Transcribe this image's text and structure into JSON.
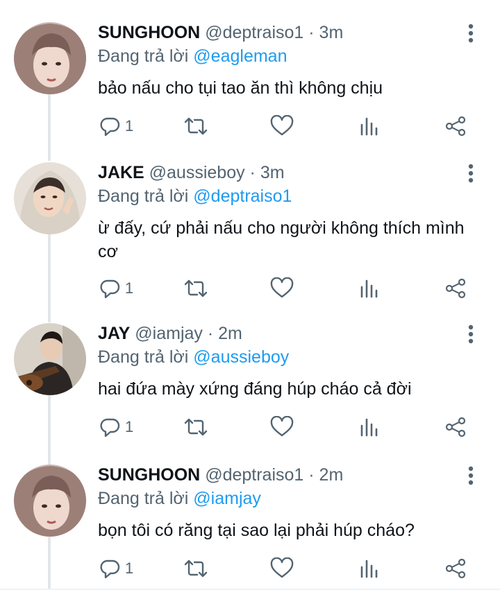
{
  "reply_prefix": "Đang trả lời",
  "tweets": [
    {
      "name": "SUNGHOON",
      "handle": "@deptraiso1",
      "time": "· 3m",
      "reply_to": "@eagleman",
      "text": "bảo nấu cho tụi tao ăn thì không chịu",
      "replies": "1"
    },
    {
      "name": "JAKE",
      "handle": "@aussieboy",
      "time": "· 3m",
      "reply_to": "@deptraiso1",
      "text": "ừ đấy, cứ phải nấu cho người không thích mình cơ",
      "replies": "1"
    },
    {
      "name": "JAY",
      "handle": "@iamjay",
      "time": "· 2m",
      "reply_to": "@aussieboy",
      "text": "hai đứa mày xứng đáng húp cháo cả đời",
      "replies": "1"
    },
    {
      "name": "SUNGHOON",
      "handle": "@deptraiso1",
      "time": "· 2m",
      "reply_to": "@iamjay",
      "text": "bọn tôi có răng tại sao lại phải húp cháo?",
      "replies": "1"
    }
  ],
  "icons": {
    "reply": "reply-icon",
    "retweet": "retweet-icon",
    "like": "heart-icon",
    "views": "analytics-icon",
    "share": "share-icon",
    "more": "more-vertical-icon"
  },
  "colors": {
    "text": "#0f1419",
    "secondary": "#536471",
    "mention": "#1d9bf0",
    "thread_line": "#e3e6e9"
  }
}
